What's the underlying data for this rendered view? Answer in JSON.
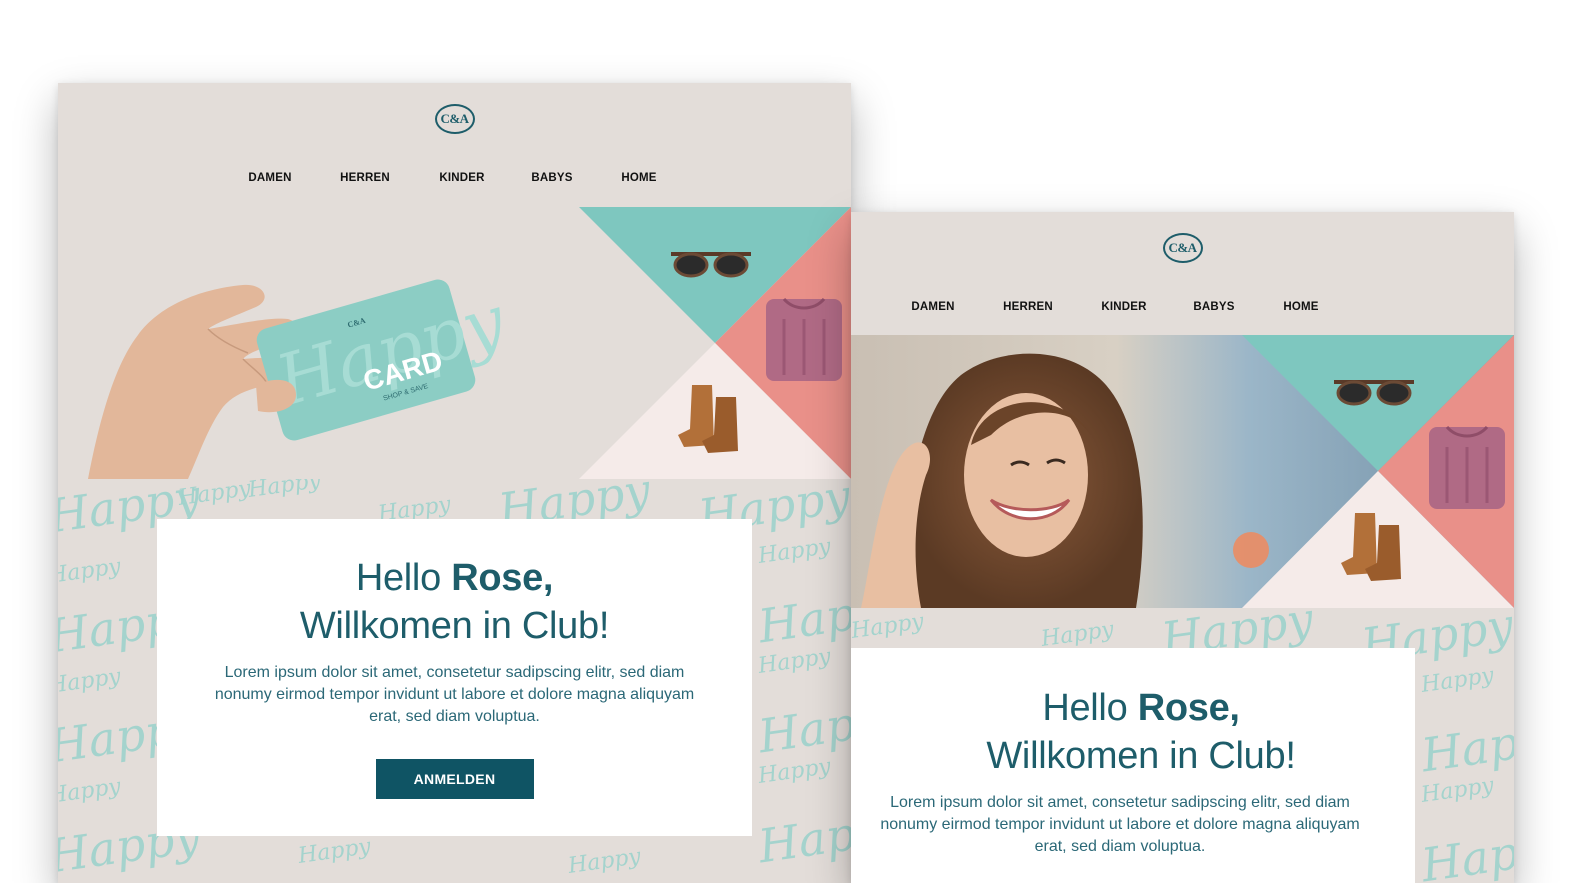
{
  "brand": {
    "logo_text": "C&A"
  },
  "colors": {
    "teal": "#7ec7bf",
    "coral": "#e99089",
    "blush": "#f5ebe9",
    "beige": "#e3ddd9",
    "navy": "#1e5d6a",
    "button": "#0f5464",
    "pattern": "#9ed3cc"
  },
  "nav": [
    "DAMEN",
    "HERREN",
    "KINDER",
    "BABYS",
    "HOME"
  ],
  "hero_card": {
    "word": "Happy",
    "title": "CARD",
    "tagline": "SHOP & SAVE",
    "logo": "C&A"
  },
  "pattern_text": "Happy",
  "icons": [
    "sunglasses-icon",
    "sweater-icon",
    "boots-icon"
  ],
  "welcome": {
    "hello": "Hello",
    "name": "Rose,",
    "line2": "Willkomen in Club!",
    "body": "Lorem ipsum dolor sit amet, consetetur sadipscing elitr, sed diam nonumy eirmod tempor invidunt ut labore et dolore magna aliquyam erat, sed diam voluptua.",
    "button": "ANMELDEN"
  }
}
